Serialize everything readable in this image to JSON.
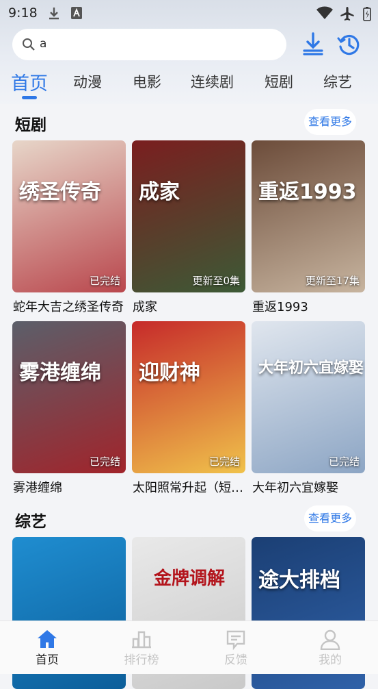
{
  "status_bar": {
    "time": "9:18"
  },
  "search": {
    "query": "a"
  },
  "tabs": [
    {
      "label": "首页"
    },
    {
      "label": "动漫"
    },
    {
      "label": "电影"
    },
    {
      "label": "连续剧"
    },
    {
      "label": "短剧"
    },
    {
      "label": "综艺"
    }
  ],
  "sections": [
    {
      "title": "短剧",
      "more_label": "查看更多",
      "items": [
        {
          "title": "蛇年大吉之绣圣传奇",
          "badge": "已完结",
          "poster_text": "绣圣传奇",
          "colors": [
            "#e7d6c9",
            "#b9474d"
          ]
        },
        {
          "title": "成家",
          "badge": "更新至0集",
          "poster_text": "成家",
          "colors": [
            "#7a1e1f",
            "#3c5a36"
          ]
        },
        {
          "title": "重返1993",
          "badge": "更新至17集",
          "poster_text": "重返1993",
          "colors": [
            "#6c4c3a",
            "#c7b49f"
          ]
        },
        {
          "title": "雾港缠绵",
          "badge": "已完结",
          "poster_text": "雾港缠绵",
          "colors": [
            "#5b5f6a",
            "#a1242b"
          ]
        },
        {
          "title": "太阳照常升起（短剧版）",
          "badge": "已完结",
          "poster_text": "迎财神",
          "colors": [
            "#c62a2a",
            "#f0c24b"
          ]
        },
        {
          "title": "大年初六宜嫁娶",
          "badge": "已完结",
          "poster_text": "大年初六宜嫁娶",
          "colors": [
            "#e0e6ee",
            "#8ca5c4"
          ]
        }
      ]
    },
    {
      "title": "综艺",
      "more_label": "查看更多",
      "items": [
        {
          "colors": [
            "#1f8dd0",
            "#0c5e9a"
          ]
        },
        {
          "poster_text": "金牌调解",
          "colors": [
            "#e9e9e9",
            "#c9c9c9"
          ]
        },
        {
          "poster_text": "途大排档",
          "colors": [
            "#1b3f74",
            "#2f61a8"
          ]
        }
      ]
    }
  ],
  "bottom_nav": [
    {
      "label": "首页",
      "icon": "home-icon"
    },
    {
      "label": "排行榜",
      "icon": "chart-icon"
    },
    {
      "label": "反馈",
      "icon": "feedback-icon"
    },
    {
      "label": "我的",
      "icon": "profile-icon"
    }
  ],
  "theme": {
    "accent": "#2f78e6"
  }
}
